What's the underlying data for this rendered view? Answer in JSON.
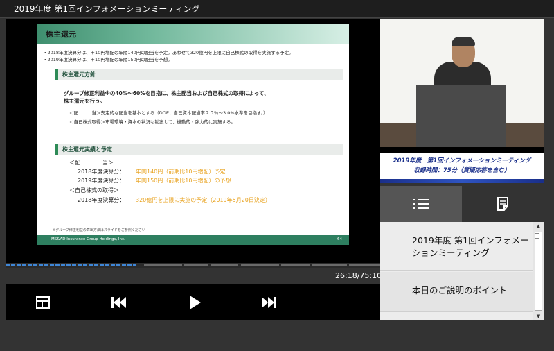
{
  "window": {
    "title": "2019年度 第1回インフォメーションミーティング"
  },
  "slide": {
    "title": "株主還元",
    "bullets": [
      "・2018年度決算分は、＋10円増配の年間140円の配当を予定。あわせて320億円を上限に自己株式の取得を実施する予定。",
      "・2019年度決算分は、＋10円増配の年間150円の配当を予想。"
    ],
    "policy": {
      "heading": "株主還元方針",
      "lead1": "グループ修正利益※の40%～60%を目指に、株主配当および自己株式の取得によって、",
      "lead2": "株主還元を行う。",
      "row1": "＜配　　　当＞安定的な配当を基本とする（DOE：自己資本配当率２０％～3.0%水準を目指す。）",
      "row2": "＜自己株式取得＞市場環境・資本の状況も勘案して、機動的・弾力的に実施する。"
    },
    "results": {
      "heading": "株主還元実績と予定",
      "div_label": "＜配　　　　当＞",
      "y2018_label": "2018年度決算分：",
      "y2018_value": "年間140円（前期比10円増配）予定",
      "y2019_label": "2019年度決算分：",
      "y2019_value": "年間150円（前期比10円増配）の予想",
      "buyback_label": "＜自己株式の取得＞",
      "buyback_year": "2018年度決算分：",
      "buyback_value": "320億円を上限に実施の予定（2019年5月20日決定）"
    },
    "footnote": "※グループ修正利益の算出方法はスライドをご参照ください",
    "footer_company": "MS&AD Insurance Group Holdings, Inc.",
    "page_number": "64"
  },
  "player": {
    "time": "26:18/75:10",
    "progress_fraction": 0.35,
    "colors": {
      "played": "#3f86d6",
      "buffer": "#6a6a6a"
    }
  },
  "controls": {
    "layout": "layout-icon",
    "prev": "skip-previous-icon",
    "play": "play-icon",
    "next": "skip-next-icon"
  },
  "video_banner": {
    "line1": "2019年度　第1回インフォメーションミーティング",
    "line2": "収録時間：75分（質疑応答を含む）"
  },
  "tabs": [
    {
      "icon": "list-icon",
      "active": true
    },
    {
      "icon": "document-icon",
      "active": false
    }
  ],
  "chapters": [
    {
      "label_line1": "2019年度 第1回インフォメー",
      "label_line2": "ションミーティング"
    },
    {
      "label_line1": "本日のご説明のポイント",
      "label_line2": ""
    }
  ]
}
